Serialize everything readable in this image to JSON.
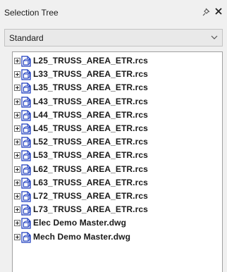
{
  "panel": {
    "title": "Selection Tree",
    "pin_icon": "pin-icon",
    "close_icon": "close-icon"
  },
  "dropdown": {
    "selected": "Standard",
    "arrow_icon": "chevron-down-icon"
  },
  "tree": {
    "items": [
      {
        "label": "L25_TRUSS_AREA_ETR.rcs",
        "icon": "file-icon"
      },
      {
        "label": "L33_TRUSS_AREA_ETR.rcs",
        "icon": "file-icon"
      },
      {
        "label": "L35_TRUSS_AREA_ETR.rcs",
        "icon": "file-icon"
      },
      {
        "label": "L43_TRUSS_AREA_ETR.rcs",
        "icon": "file-icon"
      },
      {
        "label": "L44_TRUSS_AREA_ETR.rcs",
        "icon": "file-icon"
      },
      {
        "label": "L45_TRUSS_AREA_ETR.rcs",
        "icon": "file-icon"
      },
      {
        "label": "L52_TRUSS_AREA_ETR.rcs",
        "icon": "file-icon"
      },
      {
        "label": "L53_TRUSS_AREA_ETR.rcs",
        "icon": "file-icon"
      },
      {
        "label": "L62_TRUSS_AREA_ETR.rcs",
        "icon": "file-icon"
      },
      {
        "label": "L63_TRUSS_AREA_ETR.rcs",
        "icon": "file-icon"
      },
      {
        "label": "L72_TRUSS_AREA_ETR.rcs",
        "icon": "file-icon"
      },
      {
        "label": "L73_TRUSS_AREA_ETR.rcs",
        "icon": "file-icon"
      },
      {
        "label": "Elec Demo Master.dwg",
        "icon": "file-icon"
      },
      {
        "label": "Mech Demo Master.dwg",
        "icon": "file-icon"
      }
    ]
  },
  "colors": {
    "icon_blue": "#1f3fbf",
    "panel_bg": "#f0f0f0",
    "tree_bg": "#ffffff"
  }
}
